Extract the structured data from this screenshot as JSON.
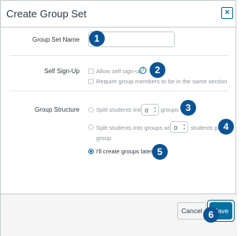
{
  "dialog": {
    "title": "Create Group Set",
    "close_icon": "×"
  },
  "form": {
    "group_set_name_label": "Group Set Name",
    "group_set_name_value": "",
    "self_signup_label": "Self Sign-Up",
    "allow_self_signup": "Allow self sign-up",
    "help_icon": "?",
    "require_same_section": "Require group members to be in the same section",
    "group_structure_label": "Group Structure",
    "split_into_prefix": "Split students into",
    "split_into_value": "0",
    "split_into_suffix": "groups",
    "split_with_prefix": "Split students into groups with",
    "split_with_value": "0",
    "split_with_suffix": "students per",
    "split_with_suffix2": "group",
    "create_later": "I'll create groups later"
  },
  "callouts": [
    "1",
    "2",
    "3",
    "4",
    "5",
    "6"
  ],
  "footer": {
    "cancel_label": "Cancel",
    "save_label": "Save"
  },
  "colors": {
    "accent": "#0770a3",
    "callout": "#0b5394",
    "border": "#c7cdd1"
  }
}
